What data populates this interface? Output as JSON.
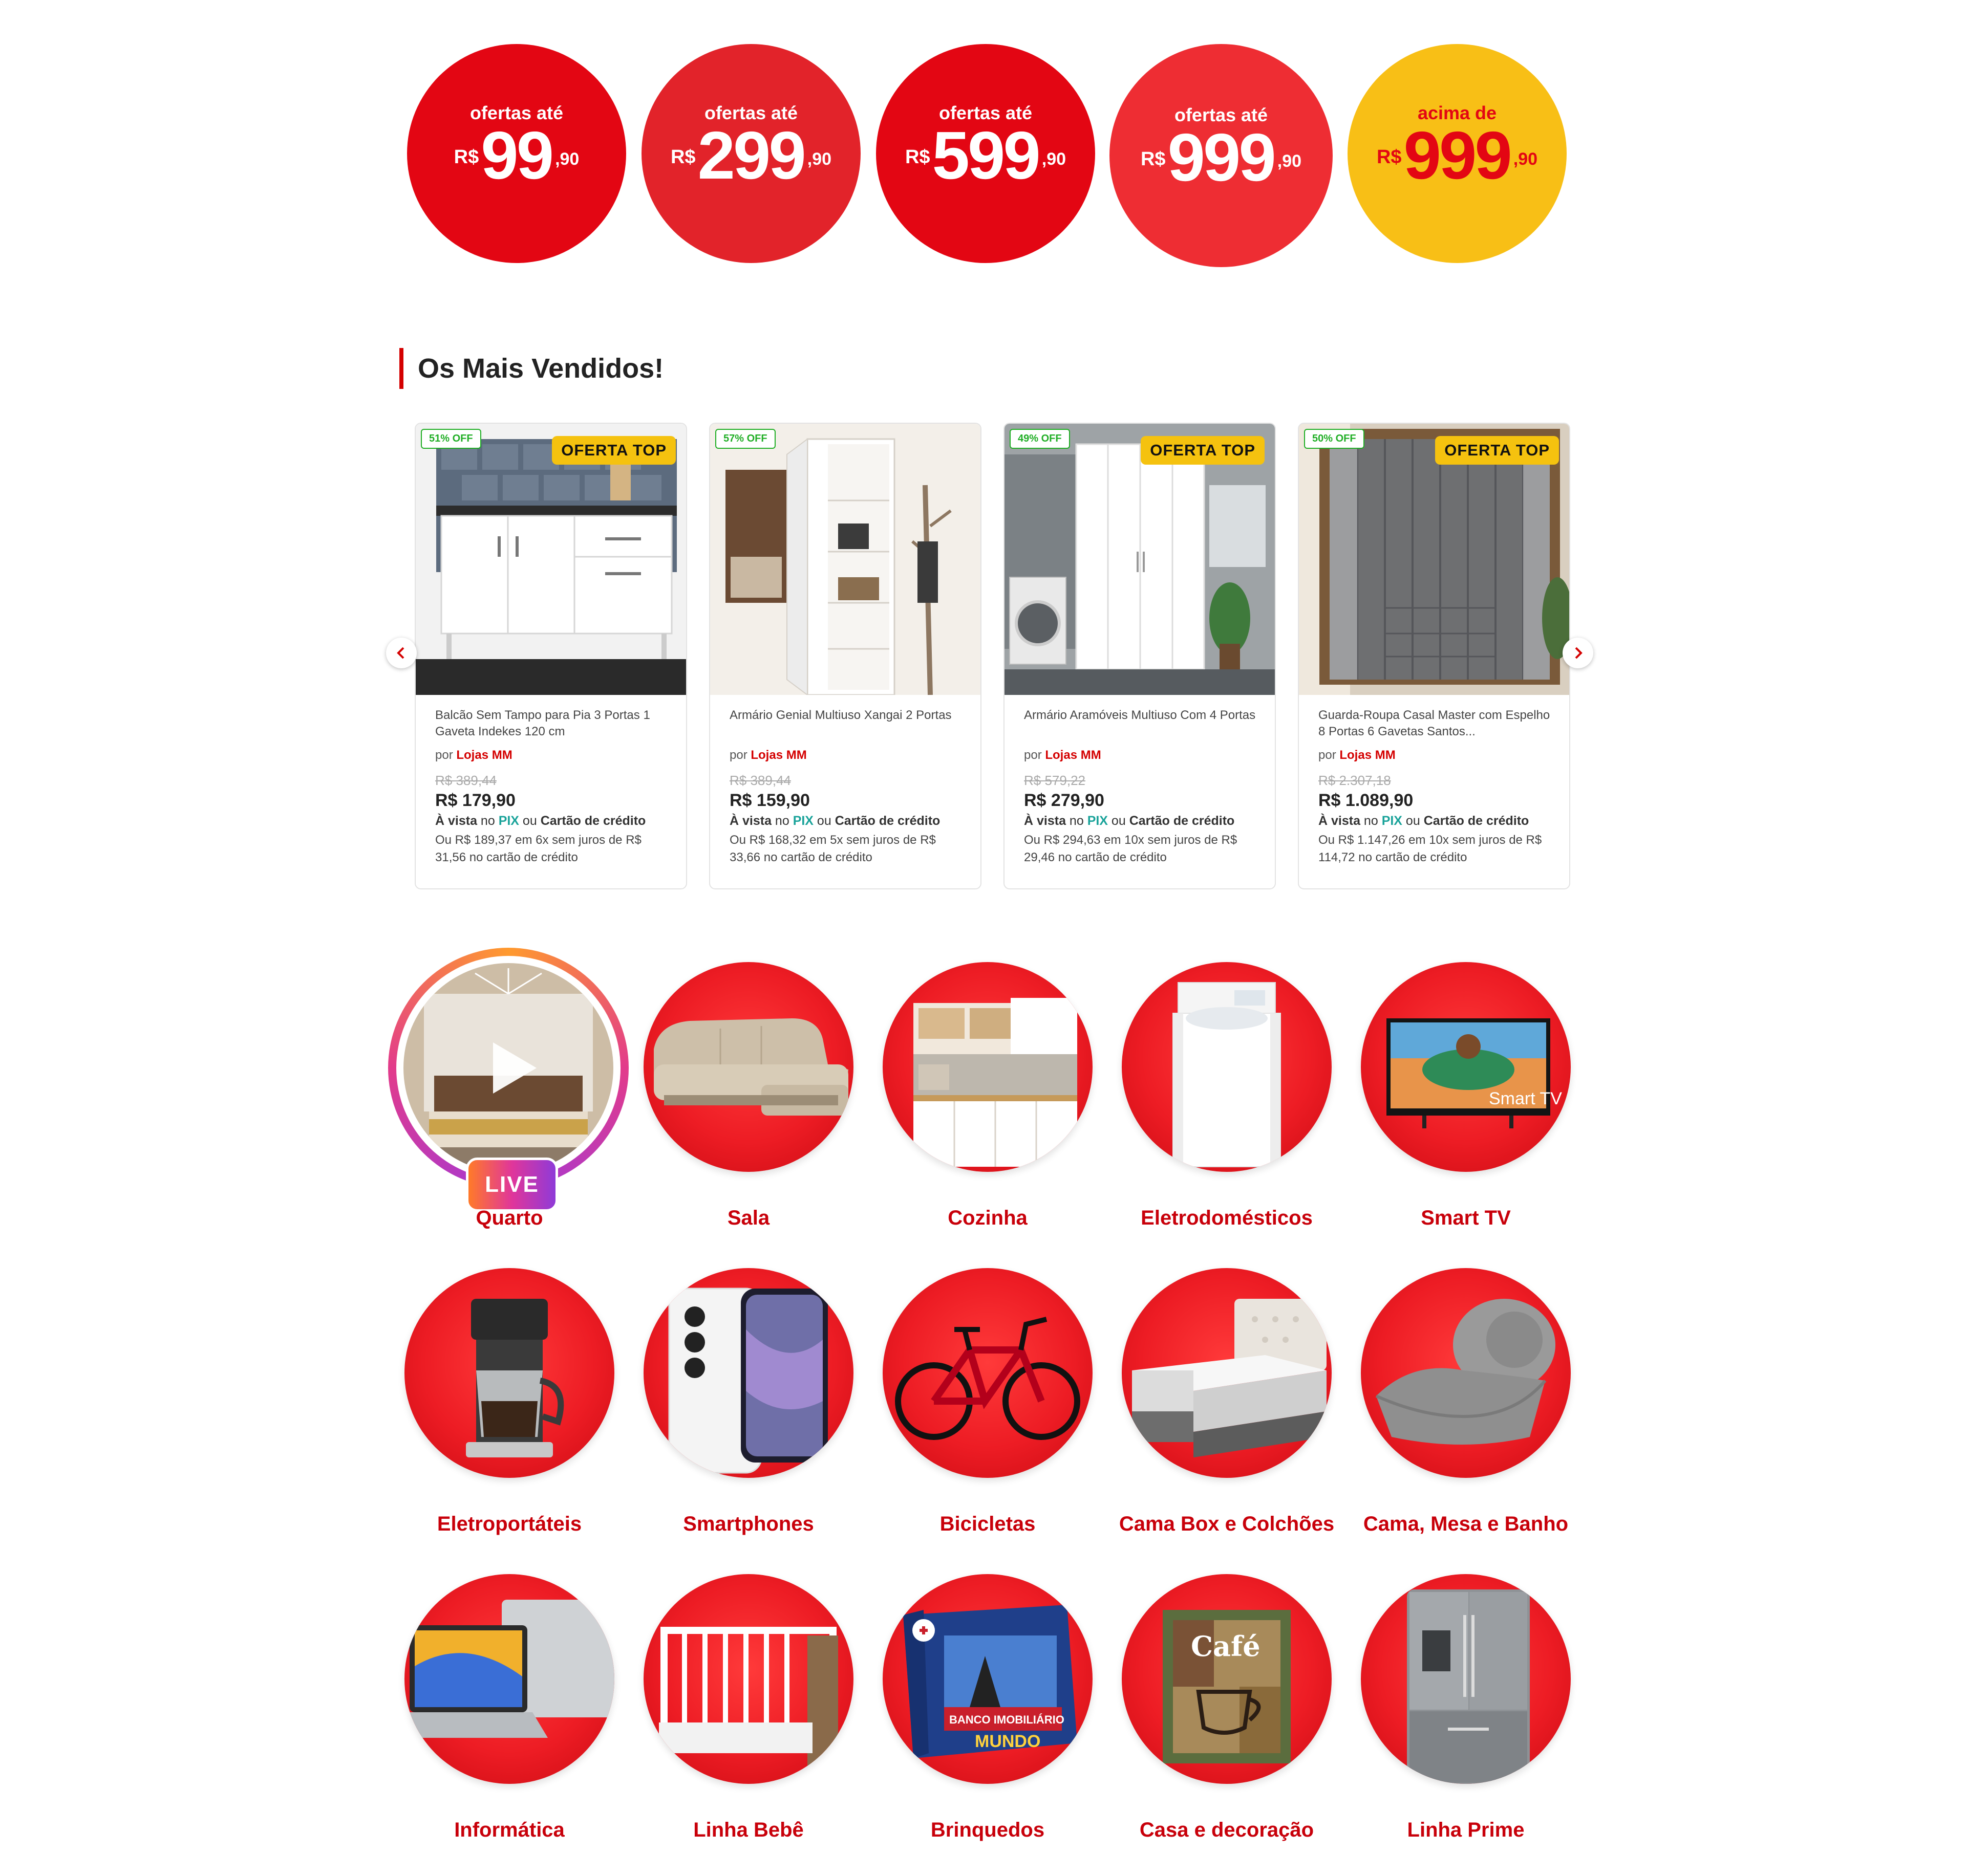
{
  "price_bubbles": [
    {
      "label": "ofertas até",
      "currency": "R$",
      "amount": "99",
      "cents": ",90",
      "color": "#e30613"
    },
    {
      "label": "ofertas até",
      "currency": "R$",
      "amount": "299",
      "cents": ",90",
      "color": "#e2232a"
    },
    {
      "label": "ofertas até",
      "currency": "R$",
      "amount": "599",
      "cents": ",90",
      "color": "#e30613"
    },
    {
      "label": "ofertas até",
      "currency": "R$",
      "amount": "999",
      "cents": ",90",
      "color": "#ee2d33"
    },
    {
      "label": "acima de",
      "currency": "R$",
      "amount": "999",
      "cents": ",90",
      "color": "#f8bf16"
    }
  ],
  "bestsellers": {
    "title": "Os Mais Vendidos!",
    "products": [
      {
        "discount": "51% OFF",
        "badge": "OFERTA TOP",
        "name": "Balcão Sem Tampo para Pia 3 Portas 1 Gaveta Indekes 120 cm",
        "seller_prefix": "por",
        "seller": "Lojas MM",
        "old_price": "R$ 389,44",
        "price": "R$ 179,90",
        "pay_a": "À vista",
        "pay_b": " no ",
        "pay_pix": "PIX",
        "pay_c": " ou ",
        "pay_card": "Cartão de crédito",
        "installments": "Ou R$ 189,37 em 6x sem juros de R$ 31,56 no cartão de crédito"
      },
      {
        "discount": "57% OFF",
        "badge": "",
        "name": "Armário Genial Multiuso Xangai 2 Portas",
        "seller_prefix": "por",
        "seller": "Lojas MM",
        "old_price": "R$ 389,44",
        "price": "R$ 159,90",
        "pay_a": "À vista",
        "pay_b": " no ",
        "pay_pix": "PIX",
        "pay_c": " ou ",
        "pay_card": "Cartão de crédito",
        "installments": "Ou R$ 168,32 em 5x sem juros de R$ 33,66 no cartão de crédito"
      },
      {
        "discount": "49% OFF",
        "badge": "OFERTA TOP",
        "name": "Armário Aramóveis Multiuso Com 4 Portas",
        "seller_prefix": "por",
        "seller": "Lojas MM",
        "old_price": "R$ 579,22",
        "price": "R$ 279,90",
        "pay_a": "À vista",
        "pay_b": " no ",
        "pay_pix": "PIX",
        "pay_c": " ou ",
        "pay_card": "Cartão de crédito",
        "installments": "Ou R$ 294,63 em 10x sem juros de R$ 29,46 no cartão de crédito"
      },
      {
        "discount": "50% OFF",
        "badge": "OFERTA TOP",
        "name": "Guarda-Roupa Casal Master com Espelho 8 Portas 6 Gavetas Santos...",
        "seller_prefix": "por",
        "seller": "Lojas MM",
        "old_price": "R$ 2.307,18",
        "price": "R$ 1.089,90",
        "pay_a": "À vista",
        "pay_b": " no ",
        "pay_pix": "PIX",
        "pay_c": " ou ",
        "pay_card": "Cartão de crédito",
        "installments": "Ou R$ 1.147,26 em 10x sem juros de R$ 114,72 no cartão de crédito"
      }
    ],
    "prev_icon": "chevron-left-icon",
    "next_icon": "chevron-right-icon"
  },
  "categories": {
    "live_badge": "LIVE",
    "items": [
      "Quarto",
      "Sala",
      "Cozinha",
      "Eletrodomésticos",
      "Smart TV",
      "Eletroportáteis",
      "Smartphones",
      "Bicicletas",
      "Cama Box e Colchões",
      "Cama, Mesa e Banho",
      "Informática",
      "Linha Bebê",
      "Brinquedos",
      "Casa e decoração",
      "Linha Prime"
    ],
    "icons": [
      "bedroom-video",
      "sofa-icon",
      "kitchen-icon",
      "washing-machine-icon",
      "smart-tv-icon",
      "coffee-maker-icon",
      "smartphone-icon",
      "bicycle-icon",
      "mattress-icon",
      "blanket-icon",
      "laptop-icon",
      "crib-icon",
      "board-game-icon",
      "coffee-sign-icon",
      "refrigerator-icon"
    ],
    "tv_text": "Smart TV",
    "game_title": "BANCO IMOBILIÁRIO",
    "game_sub": "MUNDO",
    "cafe_text": "Café"
  }
}
